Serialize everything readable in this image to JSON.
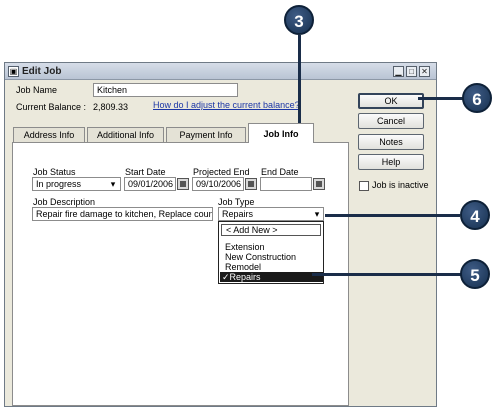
{
  "window": {
    "title": "Edit Job",
    "job_name_label": "Job Name",
    "job_name_value": "Kitchen",
    "current_balance_label": "Current Balance :",
    "current_balance_value": "2,809.33",
    "balance_help_link": "How do I adjust the current balance?"
  },
  "tabs": [
    {
      "label": "Address Info",
      "active": false
    },
    {
      "label": "Additional Info",
      "active": false
    },
    {
      "label": "Payment Info",
      "active": false
    },
    {
      "label": "Job Info",
      "active": true
    }
  ],
  "job_info": {
    "job_status_label": "Job Status",
    "job_status_value": "In progress",
    "start_date_label": "Start Date",
    "start_date_value": "09/01/2006",
    "projected_end_label": "Projected End",
    "projected_end_value": "09/10/2006",
    "end_date_label": "End Date",
    "end_date_value": "",
    "job_description_label": "Job Description",
    "job_description_value": "Repair fire damage to kitchen, Replace count...",
    "job_type_label": "Job Type",
    "job_type_value": "Repairs"
  },
  "job_type_options": [
    {
      "label": "< Add New >",
      "selected": false
    },
    {
      "label": "Extension",
      "selected": false
    },
    {
      "label": "New Construction",
      "selected": false
    },
    {
      "label": "Remodel",
      "selected": false
    },
    {
      "label": "✓Repairs",
      "selected": true
    }
  ],
  "buttons": {
    "ok": "OK",
    "cancel": "Cancel",
    "notes": "Notes",
    "help": "Help"
  },
  "job_inactive_label": "Job is inactive",
  "job_inactive_checked": false,
  "callouts": [
    "3",
    "4",
    "5",
    "6"
  ],
  "colors": {
    "callout": "#203c62",
    "selected_item": "#1a1a1a",
    "link": "#1b36a6"
  }
}
